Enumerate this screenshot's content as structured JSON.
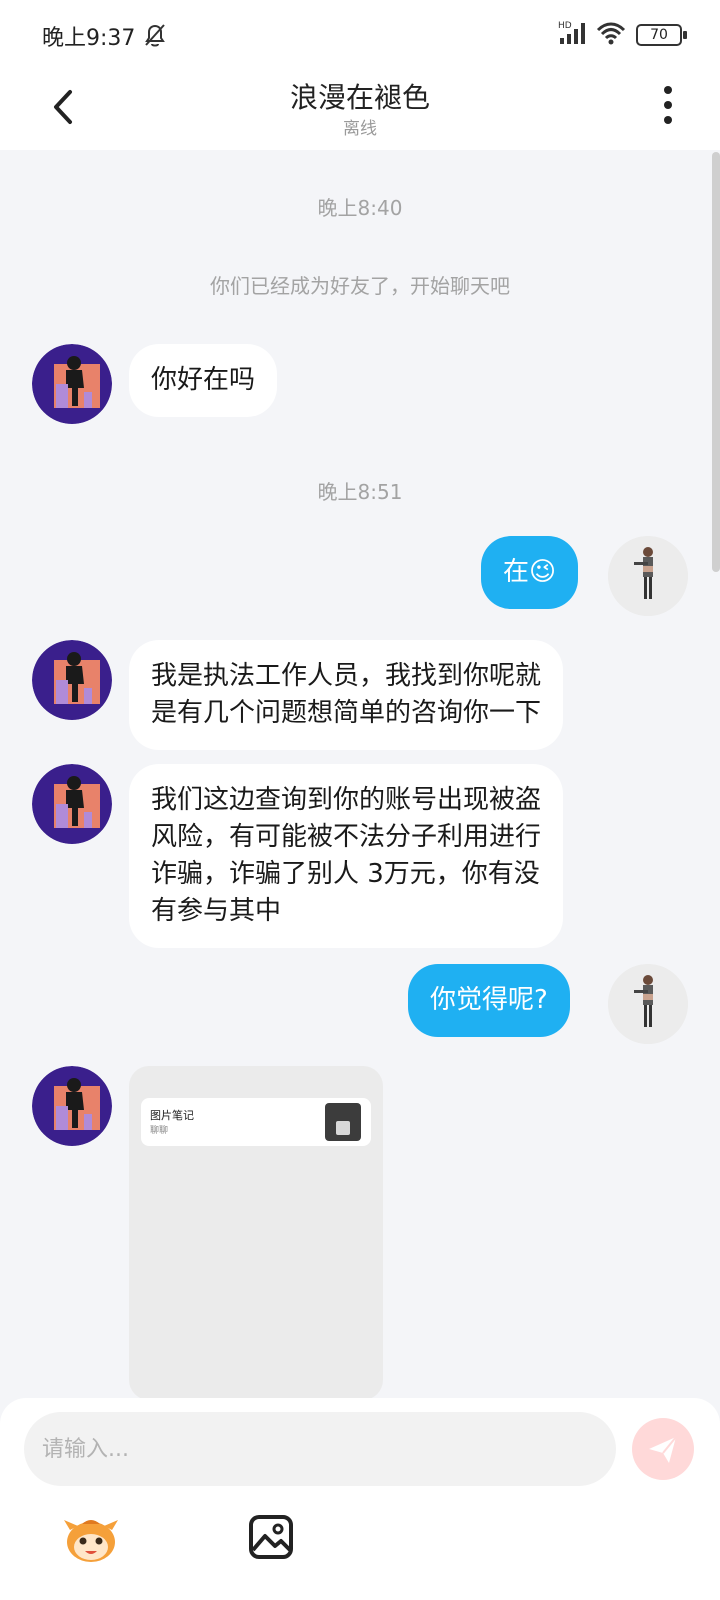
{
  "status_bar": {
    "time": "晚上9:37",
    "battery": "70"
  },
  "header": {
    "title": "浪漫在褪色",
    "status": "离线"
  },
  "messages": {
    "time_1": "晚上8:40",
    "system_note": "你们已经成为好友了，开始聊天吧",
    "msg_1": "你好在吗",
    "time_2": "晚上8:51",
    "msg_2": "在😉",
    "msg_3_line1": "我是执法工作人员，我找到你呢就",
    "msg_3_line2": "是有几个问题想简单的咨询你一下",
    "msg_4_line1": "我们这边查询到你的账号出现被盗",
    "msg_4_line2": "风险，有可能被不法分子利用进行",
    "msg_4_line3": "诈骗，诈骗了别人 3万元，你有没",
    "msg_4_line4": "有参与其中",
    "msg_5": "你觉得呢?",
    "card_title": "图片笔记",
    "card_sub": "聊聊"
  },
  "composer": {
    "placeholder": "请输入..."
  },
  "colors": {
    "bubble_out": "#1fb0f2",
    "bubble_in": "#ffffff",
    "background": "#f4f5f8",
    "send_disabled": "#ffd9d9"
  }
}
